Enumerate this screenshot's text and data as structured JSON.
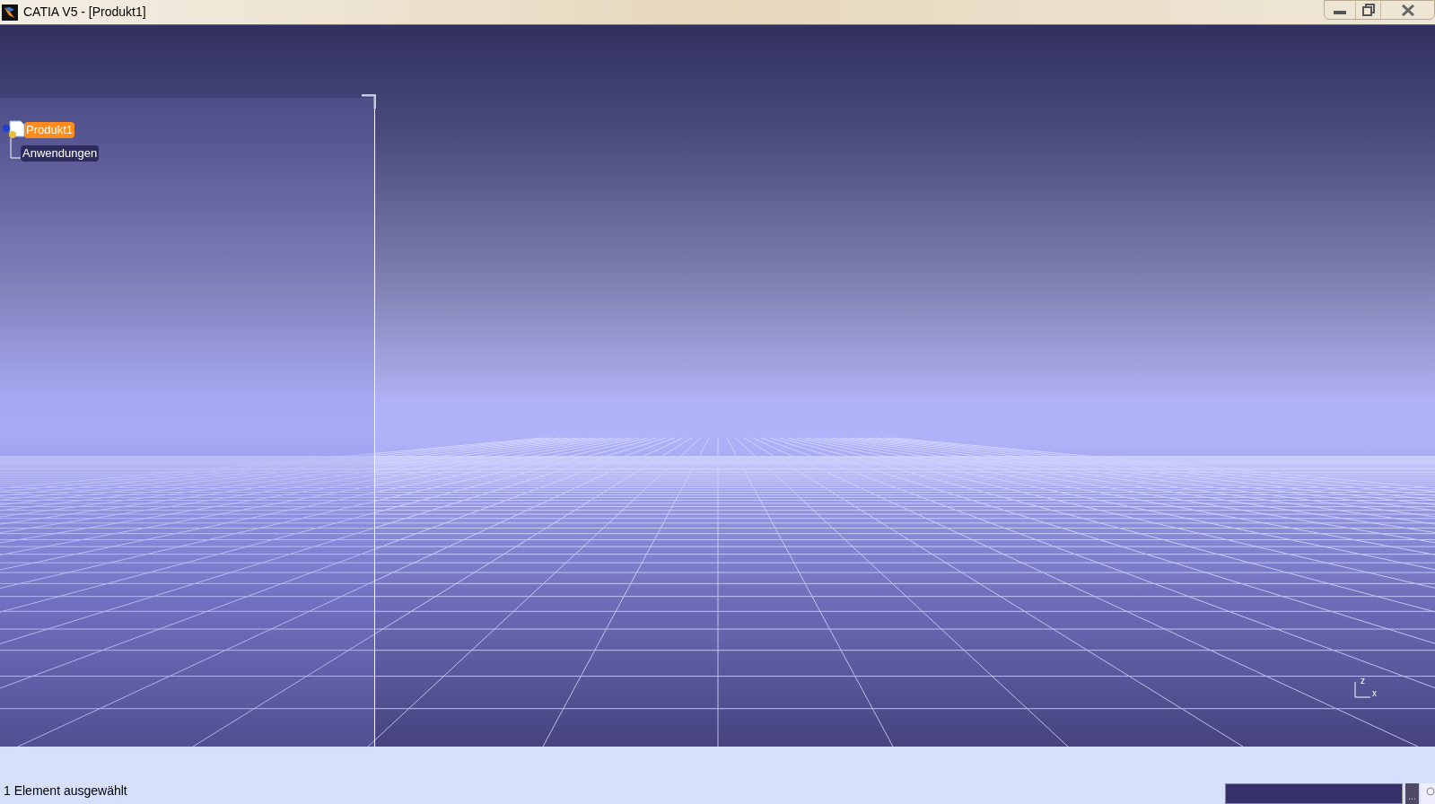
{
  "window": {
    "title": "CATIA V5 - [Produkt1]"
  },
  "tree": [
    {
      "label": "Produkt1",
      "selected": true,
      "children": [
        {
          "label": "Anwendungen",
          "selected": false
        }
      ]
    }
  ],
  "compass": {
    "axes": [
      "z",
      "x"
    ]
  },
  "status_bar": {
    "message": "1 Element ausgewählt",
    "command_button": "..."
  }
}
